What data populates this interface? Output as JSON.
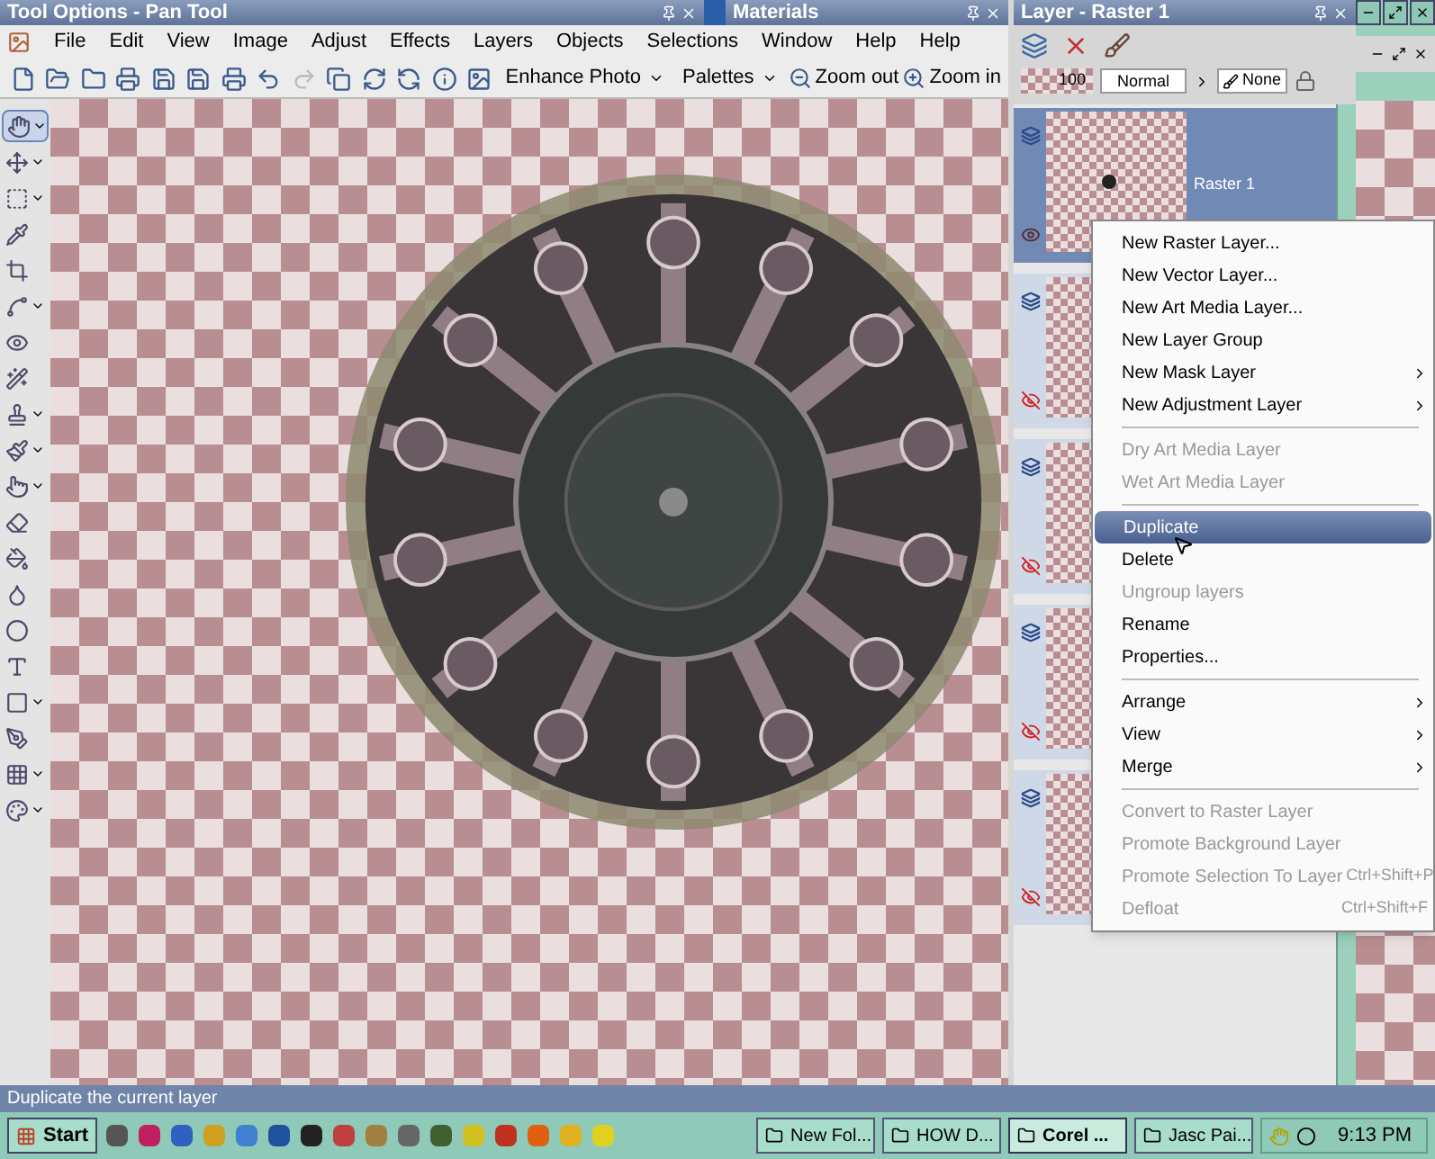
{
  "title_bars": {
    "tool_options": "Tool Options - Pan Tool",
    "materials": "Materials",
    "layer": "Layer - Raster 1"
  },
  "menu_bar": [
    "File",
    "Edit",
    "View",
    "Image",
    "Adjust",
    "Effects",
    "Layers",
    "Objects",
    "Selections",
    "Window",
    "Help",
    "Help"
  ],
  "toolbar": {
    "enhance_photo": "Enhance Photo",
    "palettes": "Palettes",
    "zoom_out": "Zoom out",
    "zoom_in": "Zoom in"
  },
  "tools": [
    {
      "selected": true,
      "dropdown": true
    },
    {
      "selected": false,
      "dropdown": true
    },
    {
      "selected": false,
      "dropdown": true
    },
    {
      "selected": false,
      "dropdown": false
    },
    {
      "selected": false,
      "dropdown": false
    },
    {
      "selected": false,
      "dropdown": true
    },
    {
      "selected": false,
      "dropdown": false
    },
    {
      "selected": false,
      "dropdown": false
    },
    {
      "selected": false,
      "dropdown": true
    },
    {
      "selected": false,
      "dropdown": true
    },
    {
      "selected": false,
      "dropdown": true
    },
    {
      "selected": false,
      "dropdown": false
    },
    {
      "selected": false,
      "dropdown": false
    },
    {
      "selected": false,
      "dropdown": false
    },
    {
      "selected": false,
      "dropdown": false
    },
    {
      "selected": false,
      "dropdown": false
    },
    {
      "selected": false,
      "dropdown": true
    },
    {
      "selected": false,
      "dropdown": false
    },
    {
      "selected": false,
      "dropdown": true
    },
    {
      "selected": false,
      "dropdown": true
    }
  ],
  "layer_palette": {
    "opacity": "100",
    "blend_mode": "Normal",
    "mask": "None",
    "layers": [
      {
        "name": "Raster 1",
        "selected": true,
        "visible": true
      },
      {
        "selected": false,
        "visible": false
      },
      {
        "selected": false,
        "visible": false
      },
      {
        "selected": false,
        "visible": false
      },
      {
        "selected": false,
        "visible": false
      }
    ]
  },
  "context_menu": [
    {
      "kind": "item",
      "label": "New Raster Layer...",
      "disabled": false,
      "selected": false,
      "submenu": false
    },
    {
      "kind": "item",
      "label": "New Vector Layer...",
      "disabled": false,
      "selected": false,
      "submenu": false
    },
    {
      "kind": "item",
      "label": "New Art Media Layer...",
      "disabled": false,
      "selected": false,
      "submenu": false
    },
    {
      "kind": "item",
      "label": "New Layer Group",
      "disabled": false,
      "selected": false,
      "submenu": false
    },
    {
      "kind": "item",
      "label": "New Mask Layer",
      "disabled": false,
      "selected": false,
      "submenu": true
    },
    {
      "kind": "item",
      "label": "New Adjustment Layer",
      "disabled": false,
      "selected": false,
      "submenu": true
    },
    {
      "kind": "separator"
    },
    {
      "kind": "item",
      "label": "Dry Art Media Layer",
      "disabled": true,
      "selected": false,
      "submenu": false
    },
    {
      "kind": "item",
      "label": "Wet Art Media Layer",
      "disabled": true,
      "selected": false,
      "submenu": false
    },
    {
      "kind": "separator"
    },
    {
      "kind": "item",
      "label": "Duplicate",
      "disabled": false,
      "selected": true,
      "submenu": false
    },
    {
      "kind": "item",
      "label": "Delete",
      "disabled": false,
      "selected": false,
      "submenu": false
    },
    {
      "kind": "item",
      "label": "Ungroup layers",
      "disabled": true,
      "selected": false,
      "submenu": false
    },
    {
      "kind": "item",
      "label": "Rename",
      "disabled": false,
      "selected": false,
      "submenu": false
    },
    {
      "kind": "item",
      "label": "Properties...",
      "disabled": false,
      "selected": false,
      "submenu": false
    },
    {
      "kind": "separator"
    },
    {
      "kind": "item",
      "label": "Arrange",
      "disabled": false,
      "selected": false,
      "submenu": true
    },
    {
      "kind": "item",
      "label": "View",
      "disabled": false,
      "selected": false,
      "submenu": true
    },
    {
      "kind": "item",
      "label": "Merge",
      "disabled": false,
      "selected": false,
      "submenu": true
    },
    {
      "kind": "separator"
    },
    {
      "kind": "item",
      "label": "Convert to Raster Layer",
      "disabled": true,
      "selected": false,
      "submenu": false
    },
    {
      "kind": "item",
      "label": "Promote Background Layer",
      "disabled": true,
      "selected": false,
      "submenu": false
    },
    {
      "kind": "item",
      "label": "Promote Selection To Layer",
      "shortcut": "Ctrl+Shift+P",
      "disabled": true,
      "selected": false,
      "submenu": false
    },
    {
      "kind": "item",
      "label": "Defloat",
      "shortcut": "Ctrl+Shift+F",
      "disabled": true,
      "selected": false,
      "submenu": false
    }
  ],
  "status_bar": "Duplicate the current layer",
  "taskbar": {
    "start": "Start",
    "tasks": [
      {
        "label": "New Fol...",
        "active": false
      },
      {
        "label": "HOW D...",
        "active": false
      },
      {
        "label": "Corel ...",
        "active": true
      },
      {
        "label": "Jasc Pai...",
        "active": false
      }
    ],
    "clock": "9:13 PM"
  }
}
